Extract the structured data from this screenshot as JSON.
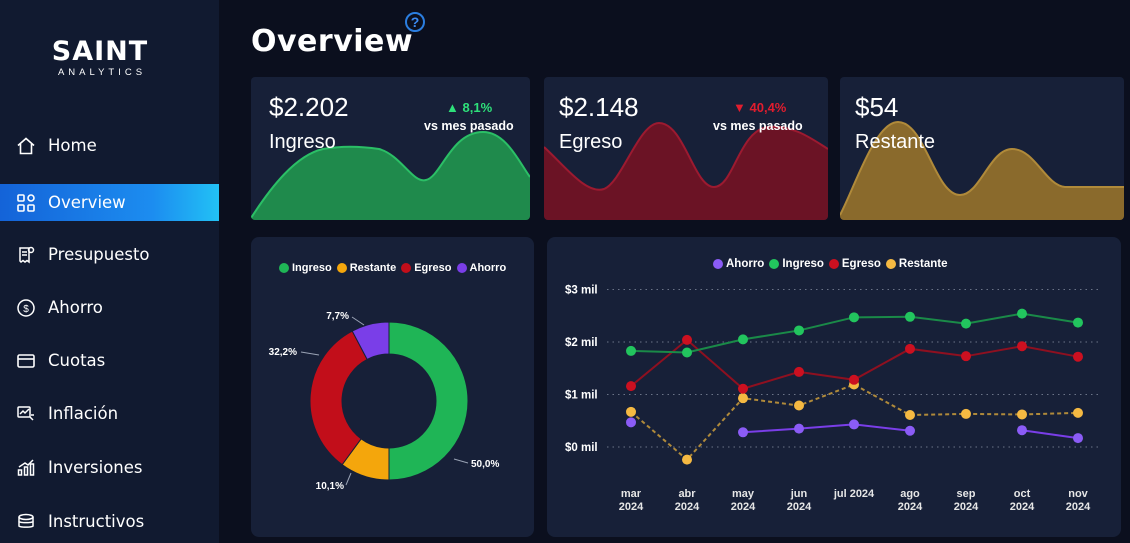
{
  "brand": {
    "name": "SAINT",
    "tagline": "ANALYTICS"
  },
  "nav": [
    {
      "label": "Home",
      "icon": "home-icon",
      "active": false
    },
    {
      "label": "Overview",
      "icon": "grid-icon",
      "active": true
    },
    {
      "label": "Presupuesto",
      "icon": "receipt-icon",
      "active": false
    },
    {
      "label": "Ahorro",
      "icon": "coin-icon",
      "active": false
    },
    {
      "label": "Cuotas",
      "icon": "credit-card-icon",
      "active": false
    },
    {
      "label": "Inflación",
      "icon": "trend-icon",
      "active": false
    },
    {
      "label": "Inversiones",
      "icon": "bar-chart-icon",
      "active": false
    },
    {
      "label": "Instructivos",
      "icon": "layers-icon",
      "active": false
    }
  ],
  "header": {
    "title": "Overview",
    "help": "?"
  },
  "kpis": [
    {
      "value": "$2.202",
      "label": "Ingreso",
      "change": "8,1%",
      "direction": "up",
      "note": "vs mes pasado",
      "color": "#1f8a4c"
    },
    {
      "value": "$2.148",
      "label": "Egreso",
      "change": "40,4%",
      "direction": "down",
      "note": "vs mes pasado",
      "color": "#6b1325"
    },
    {
      "value": "$54",
      "label": "Restante",
      "change": "",
      "direction": "",
      "note": "",
      "color": "#8a6a2c"
    }
  ],
  "colors": {
    "ingreso": "#1fb556",
    "restante": "#f4a60c",
    "egreso": "#c20e1a",
    "ahorro": "#7a3ee8",
    "line_ingreso": "#1a8a48",
    "line_egreso": "#8e1020",
    "line_ahorro": "#7a3ee8",
    "line_restante": "#b08a3a",
    "dot_ingreso": "#22c55e",
    "dot_egreso": "#cc1020",
    "dot_ahorro": "#8b5cf6",
    "dot_restante": "#f5b942"
  },
  "chart_data": [
    {
      "type": "pie",
      "legend": [
        "Ingreso",
        "Restante",
        "Egreso",
        "Ahorro"
      ],
      "slices": [
        {
          "name": "Ingreso",
          "value": 50.0,
          "label": "50,0%"
        },
        {
          "name": "Restante",
          "value": 10.1,
          "label": "10,1%"
        },
        {
          "name": "Egreso",
          "value": 32.2,
          "label": "32,2%"
        },
        {
          "name": "Ahorro",
          "value": 7.7,
          "label": "7,7%"
        }
      ]
    },
    {
      "type": "line",
      "legend": [
        "Ahorro",
        "Ingreso",
        "Egreso",
        "Restante"
      ],
      "categories": [
        "mar 2024",
        "abr 2024",
        "may 2024",
        "jun 2024",
        "jul 2024",
        "ago 2024",
        "sep 2024",
        "oct 2024",
        "nov 2024"
      ],
      "x_labels": [
        [
          "mar",
          "2024"
        ],
        [
          "abr",
          "2024"
        ],
        [
          "may",
          "2024"
        ],
        [
          "jun",
          "2024"
        ],
        [
          "jul 2024"
        ],
        [
          "ago",
          "2024"
        ],
        [
          "sep",
          "2024"
        ],
        [
          "oct",
          "2024"
        ],
        [
          "nov",
          "2024"
        ]
      ],
      "y_ticks": [
        {
          "value": 0,
          "label": "$0 mil"
        },
        {
          "value": 1000,
          "label": "$1 mil"
        },
        {
          "value": 2000,
          "label": "$2 mil"
        },
        {
          "value": 3000,
          "label": "$3 mil"
        }
      ],
      "ylim": [
        0,
        3000
      ],
      "series": [
        {
          "name": "Ahorro",
          "values": [
            470,
            null,
            280,
            350,
            430,
            310,
            null,
            320,
            170
          ]
        },
        {
          "name": "Ingreso",
          "values": [
            1830,
            1800,
            2050,
            2220,
            2470,
            2480,
            2350,
            2540,
            2370
          ]
        },
        {
          "name": "Egreso",
          "values": [
            1160,
            2040,
            1110,
            1430,
            1280,
            1870,
            1730,
            1920,
            1720
          ]
        },
        {
          "name": "Restante",
          "values": [
            670,
            -240,
            930,
            790,
            1190,
            610,
            630,
            620,
            650
          ]
        }
      ],
      "grid": true
    }
  ]
}
